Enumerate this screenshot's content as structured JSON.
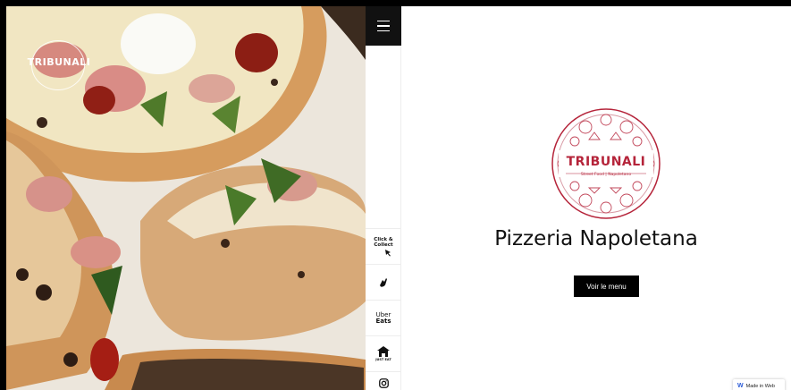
{
  "hero": {
    "logo_text": "TRIBUNALI",
    "image": "pizza-photo"
  },
  "sidenav": {
    "menu_icon": "hamburger-icon",
    "items": [
      {
        "label": "Click & Collect",
        "line1": "Click &",
        "line2": "Collect",
        "icon": "cursor-arrow-icon"
      },
      {
        "label": "Delivery",
        "icon": "delivery-hand-icon"
      },
      {
        "label": "Uber Eats",
        "line1": "Uber",
        "line2": "Eats"
      },
      {
        "label": "JUST EAT",
        "icon": "just-eat-house-icon"
      },
      {
        "label": "Instagram",
        "icon": "instagram-icon"
      }
    ]
  },
  "main": {
    "logo": {
      "name": "TRIBUNALI",
      "tagline_left": "Street Food",
      "tagline_right": "Napoletano",
      "color": "#b5243a"
    },
    "heading": "Pizzeria Napoletana",
    "cta_label": "Voir le menu"
  },
  "badge": {
    "label": "Made in Web",
    "icon": "w-logo-icon"
  }
}
